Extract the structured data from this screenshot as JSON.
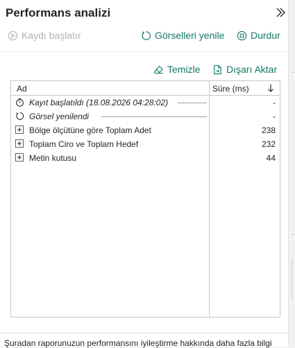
{
  "pane": {
    "title": "Performans analizi",
    "collapse_icon": "double-chevron-right-icon"
  },
  "toolbar": {
    "record_label": "Kaydı başlatır",
    "refresh_label": "Görselleri yenile",
    "stop_label": "Durdur",
    "clear_label": "Temizle",
    "export_label": "Dışarı Aktar"
  },
  "colors": {
    "accent": "#117865",
    "disabled": "#b3b0ad",
    "text": "#252423",
    "border": "#c8c6c4"
  },
  "table": {
    "columns": {
      "name": "Ad",
      "duration": "Süre (ms)"
    },
    "sort_icon": "arrow-down-icon",
    "rows": [
      {
        "icon": "stopwatch-icon",
        "label": "Kayıt başlatıldı (18.08.2026 04:28:02)",
        "value": "-"
      },
      {
        "icon": "refresh-icon",
        "label": "Görsel yenilendi",
        "value": "-"
      },
      {
        "icon": "expand-plus-icon",
        "label": "Bölge ölçütüne göre Toplam Adet",
        "value": "238"
      },
      {
        "icon": "expand-plus-icon",
        "label": "Toplam Ciro ve Toplam Hedef",
        "value": "232"
      },
      {
        "icon": "expand-plus-icon",
        "label": "Metin kutusu",
        "value": "44"
      }
    ]
  },
  "footer": {
    "text": "Şuradan raporunuzun performansını iyileştirme hakkında daha fazla bilgi"
  }
}
